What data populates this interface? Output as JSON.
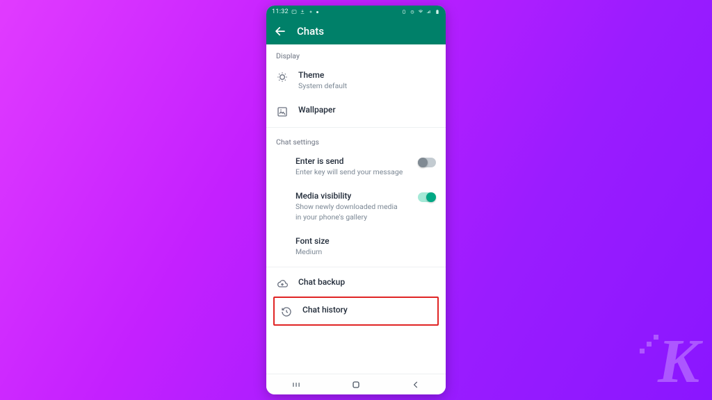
{
  "statusbar": {
    "time": "11:32"
  },
  "appbar": {
    "title": "Chats"
  },
  "sections": {
    "display": {
      "label": "Display",
      "theme": {
        "title": "Theme",
        "subtitle": "System default"
      },
      "wallpaper": {
        "title": "Wallpaper"
      }
    },
    "chat_settings": {
      "label": "Chat settings",
      "enter_is_send": {
        "title": "Enter is send",
        "subtitle": "Enter key will send your message",
        "enabled": false
      },
      "media_visibility": {
        "title": "Media visibility",
        "subtitle": "Show newly downloaded media in your phone's gallery",
        "enabled": true
      },
      "font_size": {
        "title": "Font size",
        "subtitle": "Medium"
      }
    },
    "chat_backup": {
      "title": "Chat backup"
    },
    "chat_history": {
      "title": "Chat history"
    }
  }
}
